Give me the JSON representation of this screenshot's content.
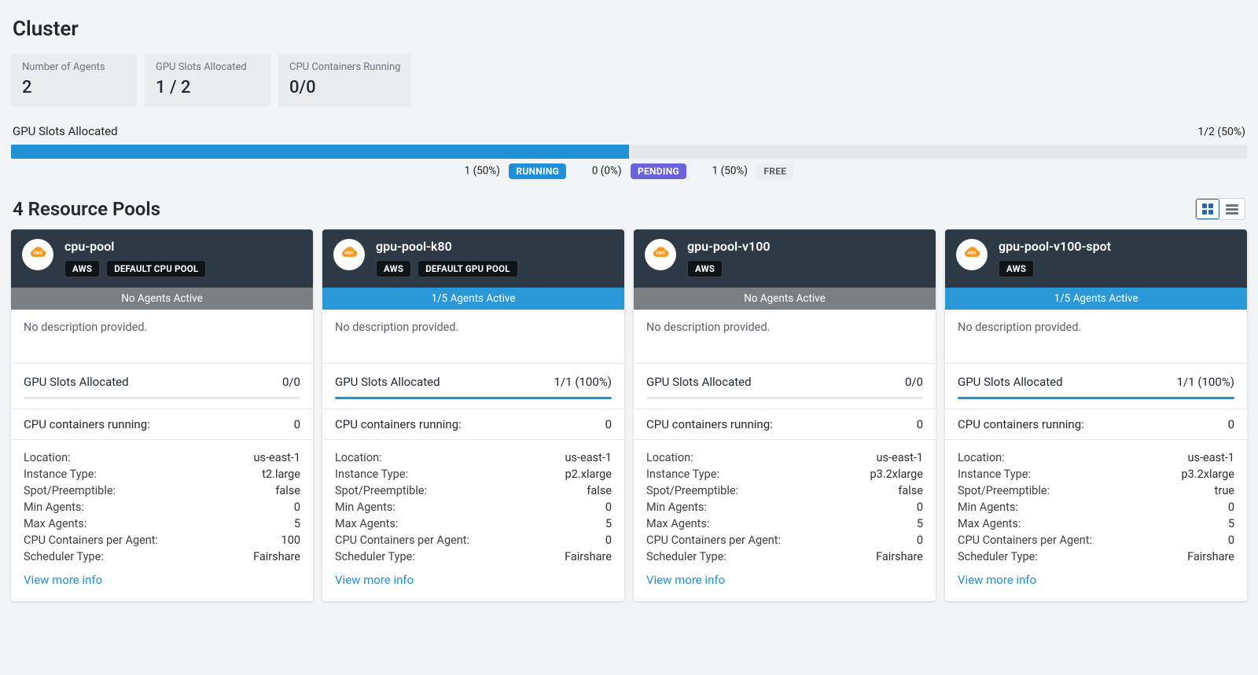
{
  "labels": {
    "cluster_title": "Cluster",
    "num_agents": "Number of Agents",
    "gpu_slots_alloc": "GPU Slots Allocated",
    "cpu_containers_running": "CPU Containers Running",
    "alloc_header": "GPU Slots Allocated",
    "legend_running": "RUNNING",
    "legend_pending": "PENDING",
    "legend_free": "FREE",
    "pools_header": "4 Resource Pools",
    "no_desc": "No description provided.",
    "card_gpu_label": "GPU Slots Allocated",
    "card_cpu_label": "CPU containers running:",
    "k_location": "Location:",
    "k_instance": "Instance Type:",
    "k_spot": "Spot/Preemptible:",
    "k_min": "Min Agents:",
    "k_max": "Max Agents:",
    "k_cpu_per_agent": "CPU Containers per Agent:",
    "k_scheduler": "Scheduler Type:",
    "more": "View more info"
  },
  "stats": {
    "num_agents": "2",
    "gpu_slots": "1 / 2",
    "cpu_containers": "0/0"
  },
  "allocation": {
    "right": "1/2 (50%)",
    "running": "1 (50%)",
    "pending": "0 (0%)",
    "free": "1 (50%)"
  },
  "chart_data": {
    "type": "bar",
    "title": "GPU Slots Allocated",
    "xlabel": "",
    "ylabel": "",
    "ylim": [
      0,
      100
    ],
    "total_slots": 2,
    "allocated_slots": 1,
    "percent_allocated": 50,
    "series": [
      {
        "name": "RUNNING",
        "slots": 1,
        "percent": 50
      },
      {
        "name": "PENDING",
        "slots": 0,
        "percent": 0
      },
      {
        "name": "FREE",
        "slots": 1,
        "percent": 50
      }
    ]
  },
  "pools": [
    {
      "name": "cpu-pool",
      "provider": "AWS",
      "default_label": "DEFAULT CPU POOL",
      "agents_text": "No Agents Active",
      "agents_active": false,
      "gpu_alloc_text": "0/0",
      "gpu_percent": 0,
      "cpu_running": "0",
      "details": {
        "location": "us-east-1",
        "instance": "t2.large",
        "spot": "false",
        "min": "0",
        "max": "5",
        "cpu_per_agent": "100",
        "scheduler": "Fairshare"
      }
    },
    {
      "name": "gpu-pool-k80",
      "provider": "AWS",
      "default_label": "DEFAULT GPU POOL",
      "agents_text": "1/5 Agents Active",
      "agents_active": true,
      "gpu_alloc_text": "1/1 (100%)",
      "gpu_percent": 100,
      "cpu_running": "0",
      "details": {
        "location": "us-east-1",
        "instance": "p2.xlarge",
        "spot": "false",
        "min": "0",
        "max": "5",
        "cpu_per_agent": "0",
        "scheduler": "Fairshare"
      }
    },
    {
      "name": "gpu-pool-v100",
      "provider": "AWS",
      "default_label": "",
      "agents_text": "No Agents Active",
      "agents_active": false,
      "gpu_alloc_text": "0/0",
      "gpu_percent": 0,
      "cpu_running": "0",
      "details": {
        "location": "us-east-1",
        "instance": "p3.2xlarge",
        "spot": "false",
        "min": "0",
        "max": "5",
        "cpu_per_agent": "0",
        "scheduler": "Fairshare"
      }
    },
    {
      "name": "gpu-pool-v100-spot",
      "provider": "AWS",
      "default_label": "",
      "agents_text": "1/5 Agents Active",
      "agents_active": true,
      "gpu_alloc_text": "1/1 (100%)",
      "gpu_percent": 100,
      "cpu_running": "0",
      "details": {
        "location": "us-east-1",
        "instance": "p3.2xlarge",
        "spot": "true",
        "min": "0",
        "max": "5",
        "cpu_per_agent": "0",
        "scheduler": "Fairshare"
      }
    }
  ]
}
